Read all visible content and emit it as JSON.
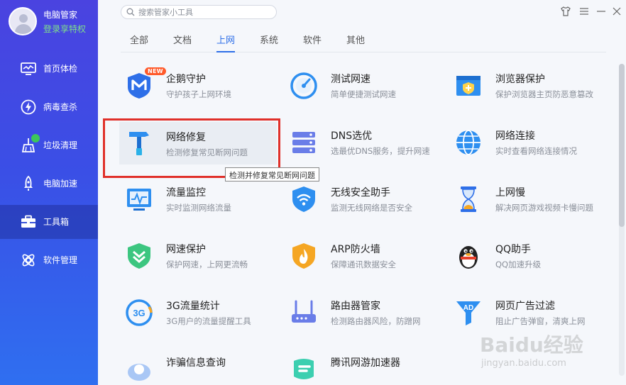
{
  "profile": {
    "name": "电脑管家",
    "vip_text": "登录享特权"
  },
  "sidebar": {
    "items": [
      {
        "label": "首页体检",
        "icon": "monitor-icon"
      },
      {
        "label": "病毒查杀",
        "icon": "lightning-icon"
      },
      {
        "label": "垃圾清理",
        "icon": "broom-icon"
      },
      {
        "label": "电脑加速",
        "icon": "rocket-icon"
      },
      {
        "label": "工具箱",
        "icon": "toolbox-icon",
        "active": true
      },
      {
        "label": "软件管理",
        "icon": "apps-icon"
      }
    ]
  },
  "search": {
    "placeholder": "搜索管家小工具"
  },
  "tabs": [
    {
      "label": "全部"
    },
    {
      "label": "文档"
    },
    {
      "label": "上网",
      "active": true
    },
    {
      "label": "系统"
    },
    {
      "label": "软件"
    },
    {
      "label": "其他"
    }
  ],
  "tools": [
    {
      "title": "企鹅守护",
      "desc": "守护孩子上网环境",
      "icon": "shield-m-icon",
      "badge": "NEW"
    },
    {
      "title": "测试网速",
      "desc": "简单便捷测试网速",
      "icon": "speedometer-icon"
    },
    {
      "title": "浏览器保护",
      "desc": "保护浏览器主页防恶意篡改",
      "icon": "browser-shield-icon"
    },
    {
      "title": "网络修复",
      "desc": "检测修复常见断网问题",
      "icon": "hammer-icon"
    },
    {
      "title": "DNS选优",
      "desc": "选最优DNS服务，提升网速",
      "icon": "server-icon"
    },
    {
      "title": "网络连接",
      "desc": "实时查看网络连接情况",
      "icon": "globe-icon"
    },
    {
      "title": "流量监控",
      "desc": "实时监测网络流量",
      "icon": "traffic-monitor-icon"
    },
    {
      "title": "无线安全助手",
      "desc": "监测无线网络是否安全",
      "icon": "wifi-shield-icon"
    },
    {
      "title": "上网慢",
      "desc": "解决网页游戏视频卡慢问题",
      "icon": "hourglass-icon"
    },
    {
      "title": "网速保护",
      "desc": "保护网速，上网更流畅",
      "icon": "speed-shield-icon"
    },
    {
      "title": "ARP防火墙",
      "desc": "保障通讯数据安全",
      "icon": "firewall-icon"
    },
    {
      "title": "QQ助手",
      "desc": "QQ加速升级",
      "icon": "penguin-icon"
    },
    {
      "title": "3G流量统计",
      "desc": "3G用户的流量提醒工具",
      "icon": "3g-icon"
    },
    {
      "title": "路由器管家",
      "desc": "检测路由器风险，防蹭网",
      "icon": "router-icon"
    },
    {
      "title": "网页广告过滤",
      "desc": "阻止广告弹窗，清爽上网",
      "icon": "ad-filter-icon"
    },
    {
      "title": "诈骗信息查询",
      "desc": "",
      "icon": "fraud-query-icon"
    },
    {
      "title": "腾讯网游加速器",
      "desc": "",
      "icon": "game-accelerator-icon"
    }
  ],
  "tooltip": "检测并修复常见断网问题",
  "watermark": {
    "line1": "Baidu经验",
    "line2": "jingyan.baidu.com"
  },
  "colors": {
    "accent": "#2e6fe8",
    "sidebar_top": "#4a43e0",
    "sidebar_bottom": "#2f6ff0",
    "highlight": "#e0302a"
  }
}
